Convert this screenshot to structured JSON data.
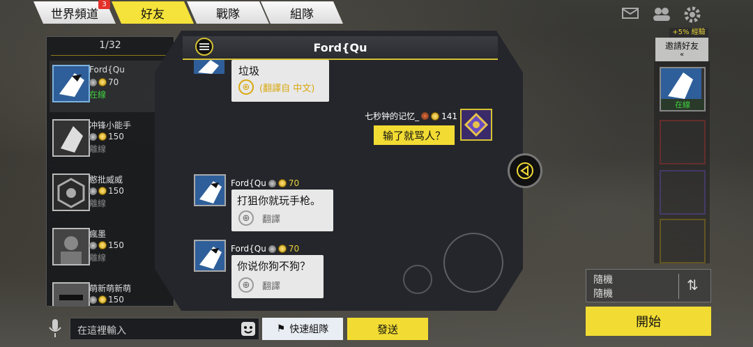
{
  "tabs": [
    {
      "label": "世界頻道",
      "badge": "3"
    },
    {
      "label": "好友"
    },
    {
      "label": "戰隊"
    },
    {
      "label": "組隊"
    }
  ],
  "friends": {
    "count": "1/32",
    "items": [
      {
        "name": "Ford{Qu",
        "level": "70",
        "status": "在線"
      },
      {
        "name": "冲锋小能手",
        "level": "150",
        "status": "離線"
      },
      {
        "name": "憨批威威",
        "level": "150",
        "status": "離線"
      },
      {
        "name": "瘋墨",
        "level": "150",
        "status": "離線"
      },
      {
        "name": "萌新萌新萌",
        "level": "150",
        "status": ""
      }
    ]
  },
  "chat": {
    "title": "Ford{Qu",
    "messages": [
      {
        "text": "垃圾",
        "translate": "(翻譯自 中文)"
      },
      {
        "sender": "七秒钟的记忆_",
        "level": "141",
        "text": "输了就骂人？"
      },
      {
        "sender": "Ford{Qu",
        "level": "70",
        "text": "打狙你就玩手枪。",
        "translate": "翻譯"
      },
      {
        "sender": "Ford{Qu",
        "level": "70",
        "text": "你说你狗不狗？",
        "translate": "翻譯"
      }
    ]
  },
  "right": {
    "exp": "+5% 經驗",
    "invite": "邀請好友",
    "online": "在線"
  },
  "mode": {
    "line1": "隨機",
    "line2": "隨機"
  },
  "start": "開始",
  "input": {
    "placeholder": "在這裡輸入"
  },
  "quick_team": "快速組隊",
  "send": "發送",
  "colors": {
    "accent": "#f2dc33",
    "online": "#3fd13f",
    "offline": "#888888"
  }
}
